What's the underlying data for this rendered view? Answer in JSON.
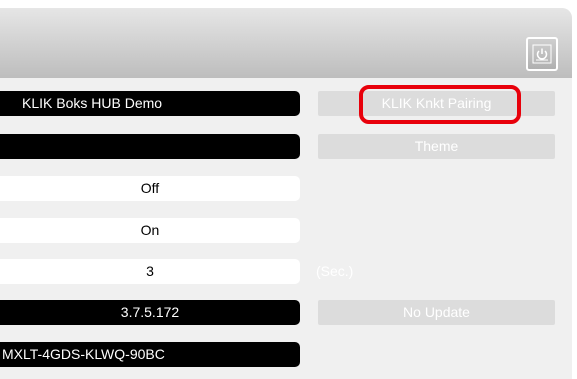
{
  "header": {
    "power_icon": "power-icon"
  },
  "fields": {
    "device_name": "KLIK Boks HUB Demo",
    "theme_value": "",
    "setting_off": "Off",
    "setting_on": "On",
    "timeout_value": "3",
    "version": "3.7.5.172",
    "serial": "MXLT-4GDS-KLWQ-90BC"
  },
  "buttons": {
    "pairing": "KLIK Knkt Pairing",
    "theme": "Theme",
    "update": "No Update"
  },
  "units": {
    "seconds": "(Sec.)"
  },
  "colors": {
    "highlight": "#e8000b",
    "dark_field": "#000000",
    "button_bg": "#dcdcdc"
  }
}
